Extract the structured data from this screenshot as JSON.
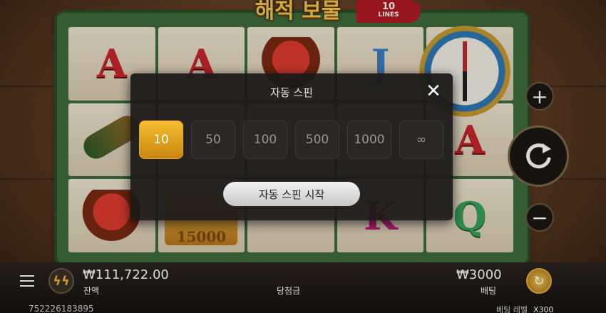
{
  "header": {
    "game_logo": "해적 보물",
    "lines_badge": {
      "number": "10",
      "label": "LINES"
    }
  },
  "reels": [
    [
      "A",
      "scope",
      "ship"
    ],
    [
      "A",
      "",
      "chest"
    ],
    [
      "ship",
      "",
      ""
    ],
    [
      "J",
      "",
      "K"
    ],
    [
      "compass",
      "A",
      "Q"
    ]
  ],
  "reel_values": {
    "chest_value": "15000"
  },
  "modal": {
    "title": "자동 스핀",
    "close_glyph": "✕",
    "options": [
      {
        "label": "10",
        "selected": true
      },
      {
        "label": "50",
        "selected": false
      },
      {
        "label": "100",
        "selected": false
      },
      {
        "label": "500",
        "selected": false
      },
      {
        "label": "1000",
        "selected": false
      },
      {
        "label": "∞",
        "selected": false
      }
    ],
    "start_label": "자동 스핀 시작"
  },
  "controls": {
    "plus_glyph": "+",
    "minus_glyph": "−",
    "spin_icon": "refresh-icon",
    "menu_icon": "hamburger-icon",
    "turbo_glyph": "ϟϟ",
    "autoplay_glyph": "↻"
  },
  "bottom_bar": {
    "balance_value": "₩111,722.00",
    "balance_label": "잔액",
    "win_label": "당첨금",
    "bet_value": "₩3000",
    "bet_label": "배팅",
    "round_id": "752226183895",
    "bet_level_label": "베팅 레벨",
    "bet_level_value": "X300"
  },
  "colors": {
    "accent": "#F2B632",
    "button_dark": "#2A2725",
    "symbol_red": "#C9262C",
    "symbol_green": "#37A35A"
  }
}
